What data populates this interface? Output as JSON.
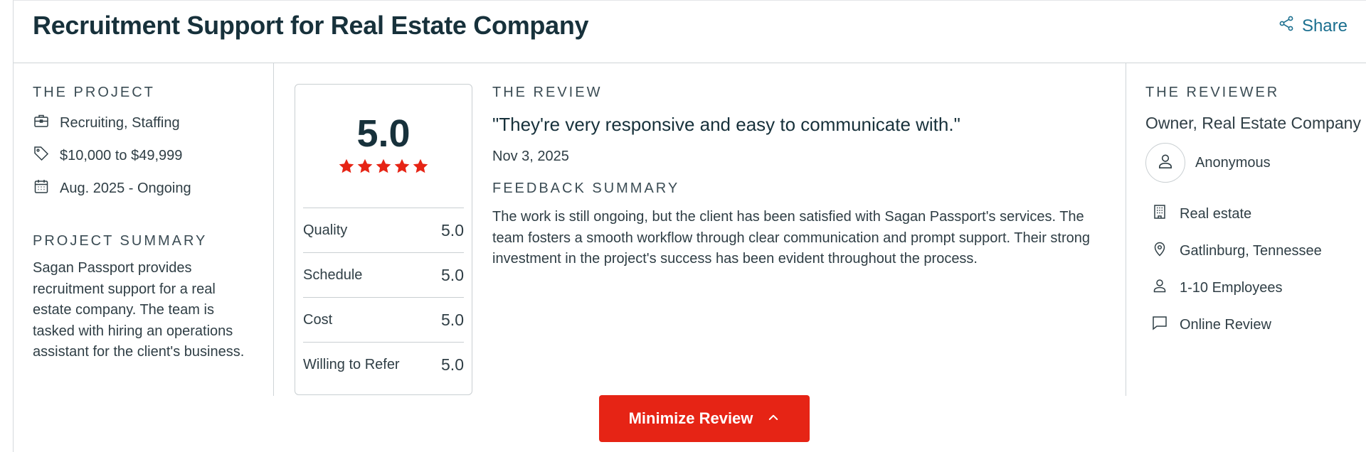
{
  "header": {
    "title": "Recruitment Support for Real Estate Company",
    "share_label": "Share"
  },
  "project": {
    "section_label": "THE PROJECT",
    "service": "Recruiting, Staffing",
    "budget": "$10,000 to $49,999",
    "timeline": "Aug. 2025 - Ongoing",
    "summary_label": "PROJECT SUMMARY",
    "summary": "Sagan Passport provides recruitment support for a real estate company. The team is tasked with hiring an operations assistant for the client's business."
  },
  "rating": {
    "overall": "5.0",
    "stars": 5,
    "star_color": "#e62415",
    "rows": [
      {
        "label": "Quality",
        "value": "5.0"
      },
      {
        "label": "Schedule",
        "value": "5.0"
      },
      {
        "label": "Cost",
        "value": "5.0"
      },
      {
        "label": "Willing to Refer",
        "value": "5.0"
      }
    ]
  },
  "review": {
    "section_label": "THE REVIEW",
    "quote": "\"They're very responsive and easy to communicate with.\"",
    "date": "Nov 3, 2025",
    "feedback_label": "FEEDBACK SUMMARY",
    "feedback": "The work is still ongoing, but the client has been satisfied with Sagan Passport's services. The team fosters a smooth workflow through clear communication and prompt support. Their strong investment in the project's success has been evident throughout the process."
  },
  "reviewer": {
    "section_label": "THE REVIEWER",
    "title": "Owner, Real Estate Company",
    "name": "Anonymous",
    "industry": "Real estate",
    "location": "Gatlinburg, Tennessee",
    "size": "1-10 Employees",
    "review_type": "Online Review"
  },
  "actions": {
    "minimize_label": "Minimize Review"
  },
  "colors": {
    "accent": "#e62415",
    "link": "#1b6f8f",
    "text": "#17313b"
  }
}
